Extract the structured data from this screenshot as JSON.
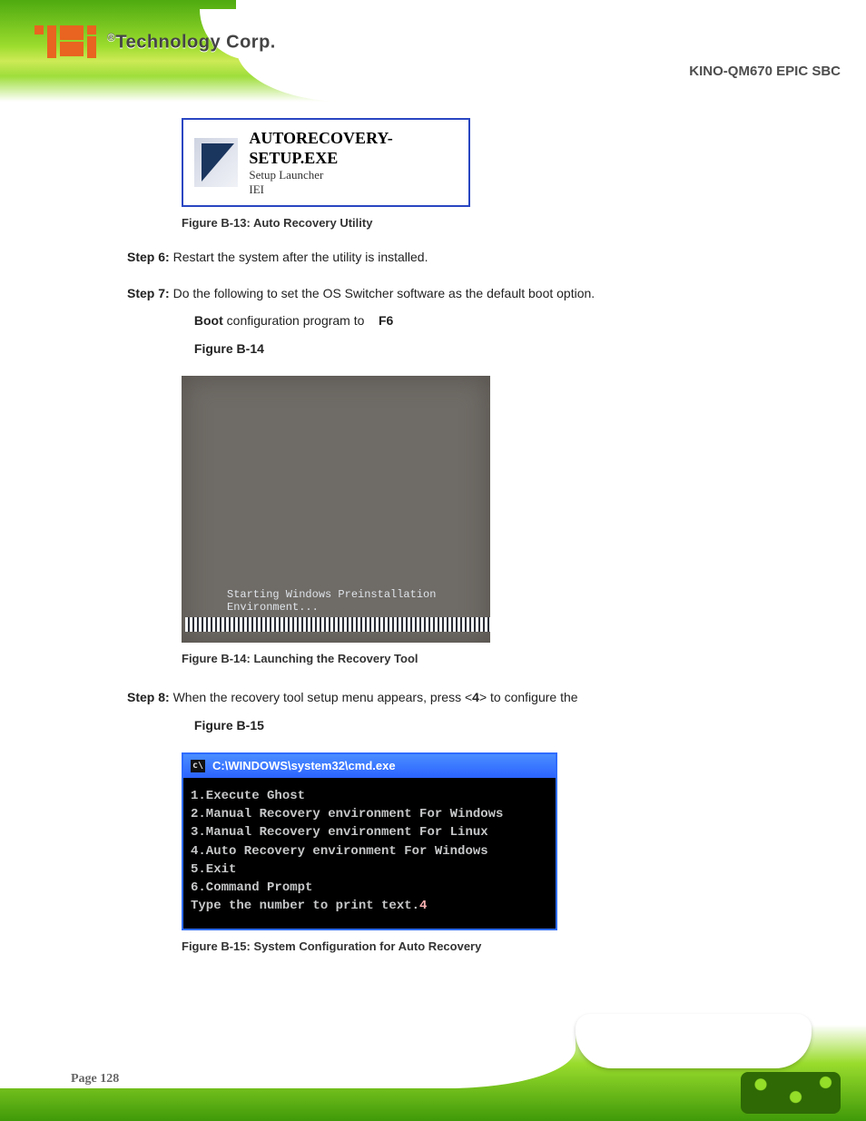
{
  "header": {
    "brand_registered": "®",
    "brand_text": "Technology Corp.",
    "page_title": "KINO-QM670 EPIC SBC"
  },
  "tile": {
    "line1": "AUTORECOVERY-SETUP.EXE",
    "line2": "Setup Launcher",
    "line3": "IEI"
  },
  "fig1_caption": "Figure B-13: Auto Recovery Utility",
  "step6": {
    "num": "Step 6:",
    "text": "Restart the system after the utility is installed."
  },
  "step7": {
    "num": "Step 7:",
    "text_a": "Do the following to set the OS Switcher software as the default boot option.",
    "boot_label": "Boot ",
    "boot_text": "configuration program to",
    "fail_label": "F6",
    "fig_ref": "Figure B-14"
  },
  "winpe": {
    "msg": "Starting Windows Preinstallation Environment..."
  },
  "fig2_caption": "Figure B-14: Launching the Recovery Tool",
  "step8": {
    "num": "Step 8:",
    "text_a": "When the recovery tool setup menu appears, press <",
    "key": "4",
    "text_b": "> to configure the",
    "fig_ref": "Figure B-15"
  },
  "cmd": {
    "title": "C:\\WINDOWS\\system32\\cmd.exe",
    "lines": [
      "1.Execute Ghost",
      "2.Manual Recovery environment For Windows",
      "3.Manual Recovery environment For Linux",
      "4.Auto Recovery environment For Windows",
      "5.Exit",
      "6.Command Prompt"
    ],
    "prompt": "Type the number to print text.",
    "entered": "4"
  },
  "fig3_caption": "Figure B-15: System Configuration for Auto Recovery",
  "footer": {
    "page_number": "Page 128"
  }
}
